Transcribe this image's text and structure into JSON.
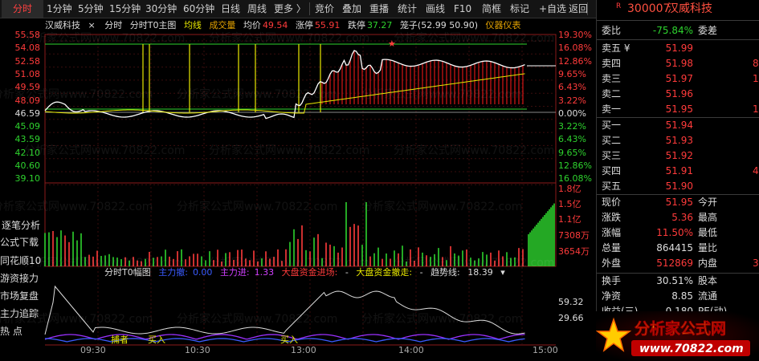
{
  "toolbar": {
    "items": [
      "分时",
      "1分钟",
      "5分钟",
      "15分钟",
      "30分钟",
      "60分钟",
      "日线",
      "周线",
      "更多 〉",
      "竞价",
      "叠加",
      "重播",
      "统计",
      "画线",
      "F10",
      "简框",
      "标记",
      "+自选",
      "返回"
    ]
  },
  "stock": {
    "flag": "R",
    "code": "300007",
    "name": "汉威科技"
  },
  "legend": {
    "name": "汉威科技",
    "mode": "分时",
    "indicator": "分时T0主图",
    "avg_line": "均线",
    "volume": "成交量",
    "avg_price_label": "均价",
    "avg_price": "49.54",
    "limit_up_label": "涨停",
    "limit_up": "55.91",
    "limit_down_label": "跌停",
    "limit_down": "37.27",
    "cage": "笼子(52.99 50.90)",
    "instrument": "仪器仪表"
  },
  "price_axis": {
    "left": [
      "55.58",
      "54.08",
      "52.58",
      "51.08",
      "49.59",
      "48.09",
      "46.59",
      "45.09",
      "43.59",
      "42.10",
      "40.60",
      "39.10"
    ],
    "right": [
      "19.30%",
      "16.08%",
      "12.86%",
      "9.65%",
      "6.43%",
      "3.22%",
      "0.00%",
      "3.22%",
      "6.43%",
      "9.65%",
      "12.86%",
      "16.08%"
    ]
  },
  "volume_axis": [
    "1.8亿",
    "1.5亿",
    "1.1亿",
    "7308万",
    "3654万"
  ],
  "sub_axis": [
    "59.32",
    "29.66"
  ],
  "sub_legend": {
    "title": "分时T0幅图",
    "main_out_label": "主力撤:",
    "main_out": "0.00",
    "main_in_label": "主力进:",
    "main_in": "1.33",
    "big_in": "大盘资金进场:",
    "big_out": "大盘资金撤走:",
    "big_sep": "-",
    "trend_label": "趋势线:",
    "trend": "18.39"
  },
  "sub_marks": [
    "捕者",
    "买入",
    "买入"
  ],
  "times": [
    "09:30",
    "10:30",
    "13:00",
    "14:00",
    "15:00"
  ],
  "left_tools": [
    "逐笔分析",
    "公式下载",
    "同花顺10",
    "游资接力",
    "市场复盘",
    "主力追踪",
    "热 点"
  ],
  "order_book": {
    "ratio_label": "委比",
    "ratio": "-75.84%",
    "diff_label": "委差",
    "asks": [
      {
        "label": "卖五 ¥",
        "price": "51.99",
        "vol": ""
      },
      {
        "label": "卖四",
        "price": "51.98",
        "vol": "8"
      },
      {
        "label": "卖三",
        "price": "51.97",
        "vol": "1"
      },
      {
        "label": "卖二",
        "price": "51.96",
        "vol": ""
      },
      {
        "label": "卖一",
        "price": "51.95",
        "vol": "13"
      }
    ],
    "bids": [
      {
        "label": "买一",
        "price": "51.94",
        "vol": ""
      },
      {
        "label": "买二",
        "price": "51.93",
        "vol": ""
      },
      {
        "label": "买三",
        "price": "51.92",
        "vol": ""
      },
      {
        "label": "买四",
        "price": "51.91",
        "vol": "4"
      },
      {
        "label": "买五",
        "price": "51.90",
        "vol": ""
      }
    ]
  },
  "quote": [
    {
      "l1": "现价",
      "v1": "51.95",
      "l2": "今开",
      "c1": "red"
    },
    {
      "l1": "涨跌",
      "v1": "5.36",
      "l2": "最高",
      "c1": "red"
    },
    {
      "l1": "涨幅",
      "v1": "11.50%",
      "l2": "最低",
      "c1": "red"
    },
    {
      "l1": "总量",
      "v1": "864415",
      "l2": "量比",
      "c1": "white"
    },
    {
      "l1": "外盘",
      "v1": "512869",
      "l2": "内盘",
      "c1": "red",
      "v2": "3"
    }
  ],
  "stats": [
    {
      "l1": "换手",
      "v1": "30.51%",
      "l2": "股本"
    },
    {
      "l1": "净资",
      "v1": "8.85",
      "l2": "流通"
    },
    {
      "l1": "收益(三)",
      "v1": "0.180",
      "l2": "PE(动)"
    }
  ],
  "watermark": "分析家公式网www.70822.com",
  "logo": {
    "title": "分析家公式网",
    "url": "www.70822.com"
  },
  "colors": {
    "up": "#ff3b3b",
    "down": "#2ed32e",
    "bg": "#000000",
    "yellow": "#e8e800",
    "purple": "#9b30ff",
    "blue": "#3a5bff"
  }
}
